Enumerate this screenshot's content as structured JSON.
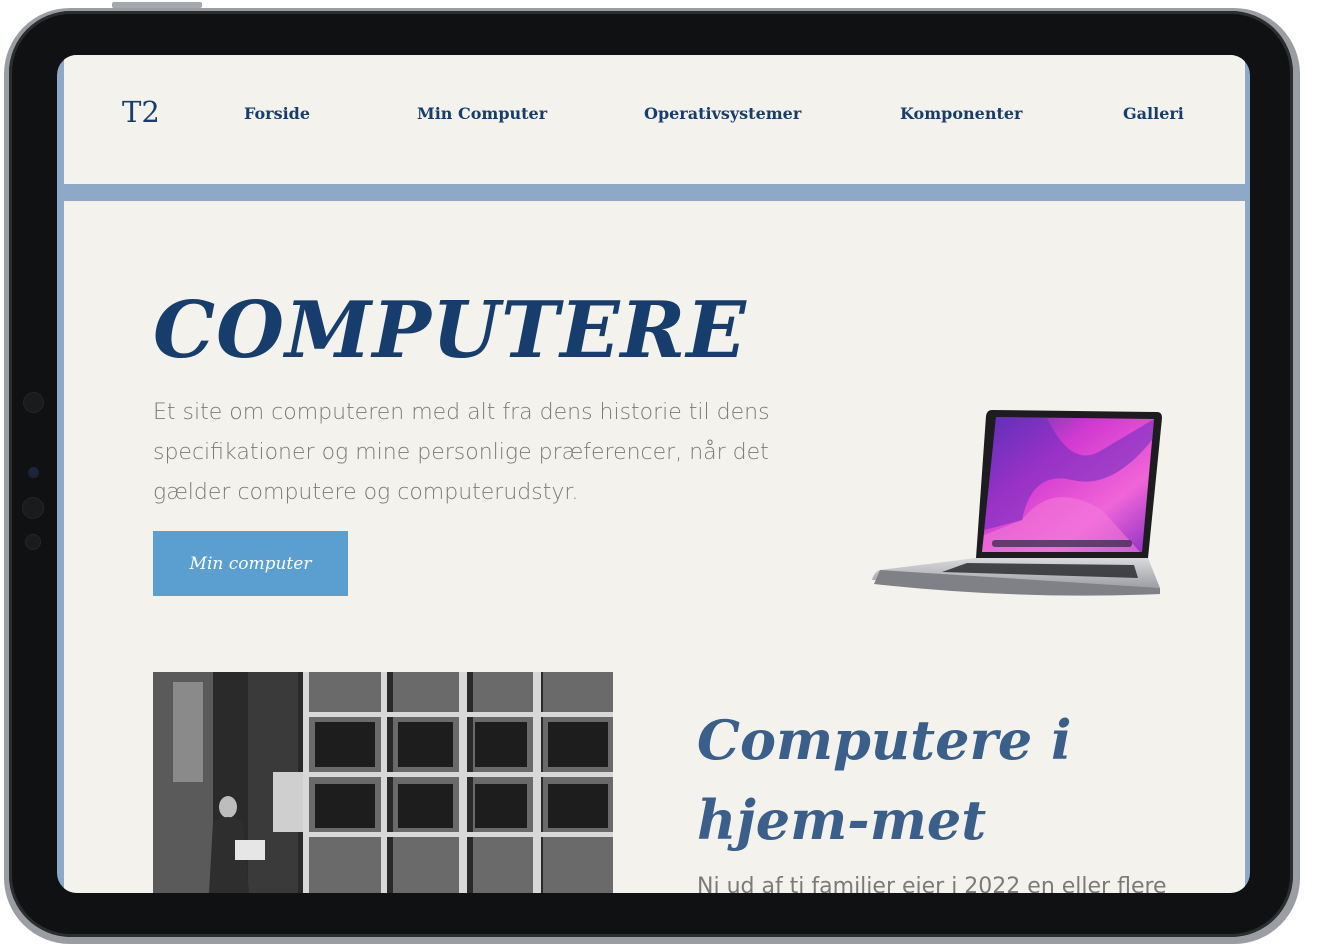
{
  "site": {
    "logo": "T2",
    "nav": [
      "Forside",
      "Min Computer",
      "Operativsystemer",
      "Komponenter",
      "Galleri"
    ]
  },
  "hero": {
    "title": "COMPUTERE",
    "text": "Et site om computeren med alt fra dens historie til dens specifikationer og mine personlige præferencer, når det gælder computere og computerudstyr.",
    "button_label": "Min computer"
  },
  "section": {
    "title": "Computere i hjem-met",
    "text": "Ni ud af ti familier ejer i 2022 en eller flere"
  },
  "colors": {
    "primary": "#173d6d",
    "accent_bar": "#8da9c7",
    "button": "#5b9fd1",
    "background": "#f3f2ec",
    "body_text": "#7c7a78"
  },
  "icons": {
    "hero_image": "laptop-image",
    "history_image": "vintage-mainframe-photo"
  }
}
